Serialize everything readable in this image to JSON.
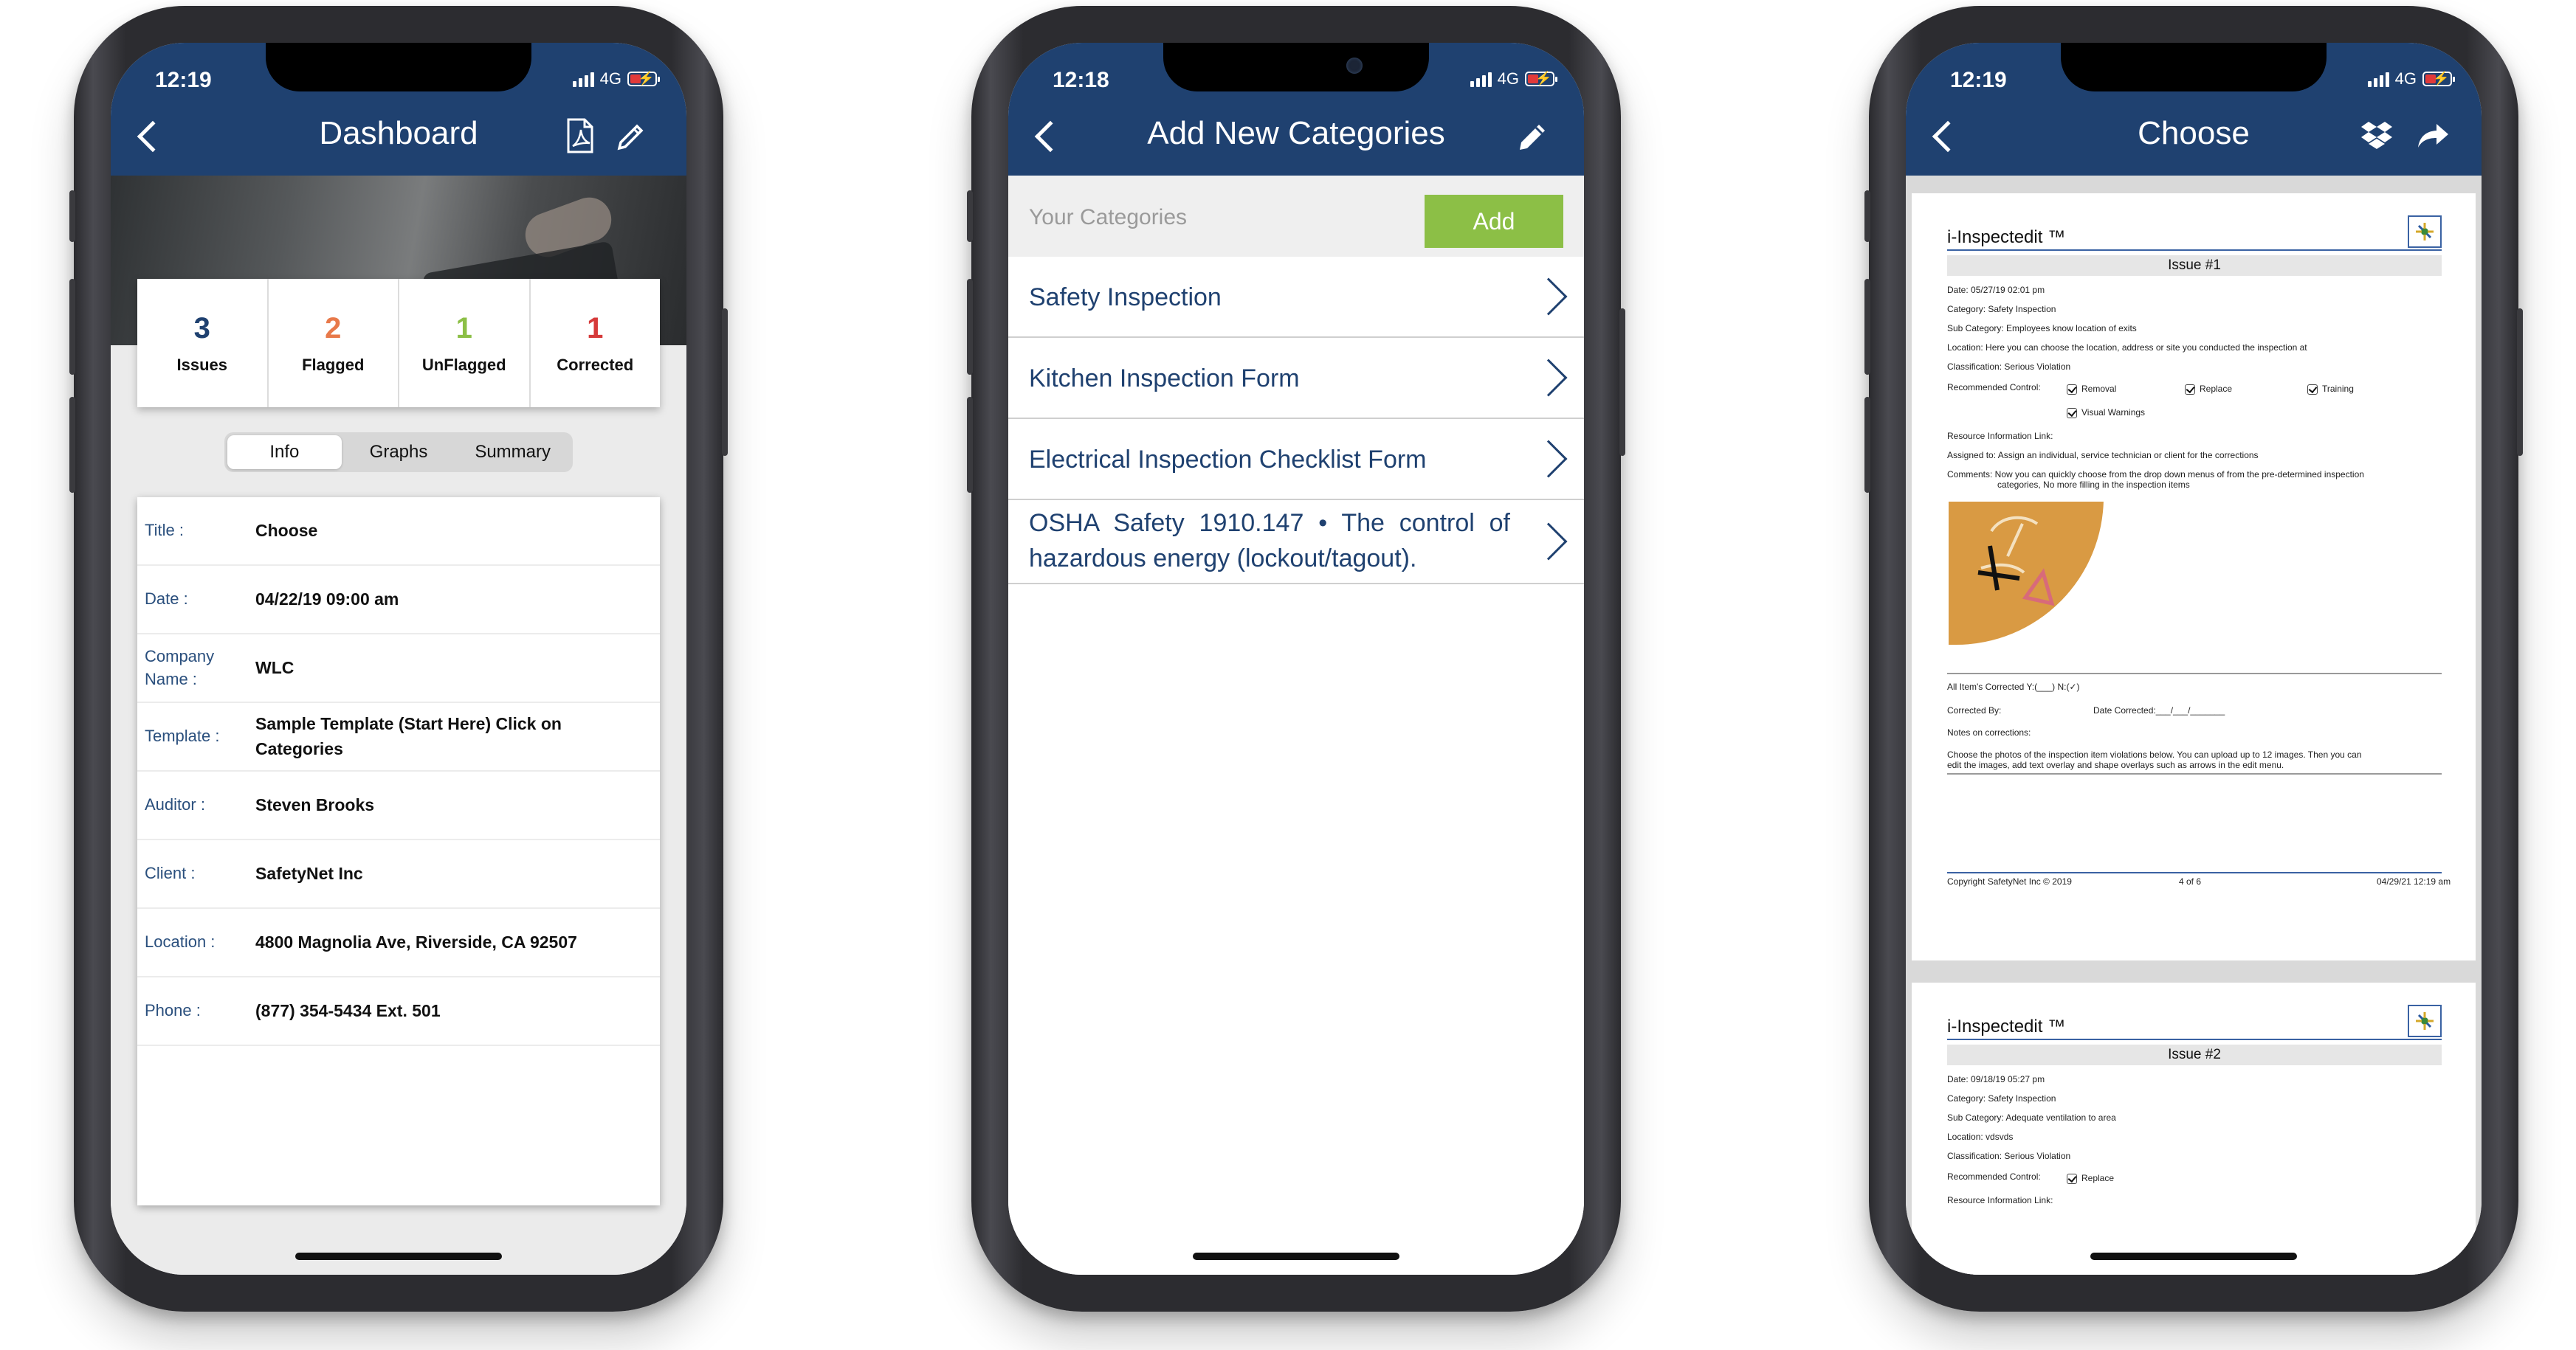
{
  "phones": [
    {
      "status_time": "12:19",
      "network": "4G",
      "title": "Dashboard",
      "stats": [
        {
          "value": "3",
          "label": "Issues",
          "color": "#1f4170"
        },
        {
          "value": "2",
          "label": "Flagged",
          "color": "#e8794a"
        },
        {
          "value": "1",
          "label": "UnFlagged",
          "color": "#8cbf46"
        },
        {
          "value": "1",
          "label": "Corrected",
          "color": "#d63a3a"
        }
      ],
      "tabs": [
        "Info",
        "Graphs",
        "Summary"
      ],
      "active_tab": "Info",
      "info": [
        {
          "key": "Title :",
          "value": "Choose"
        },
        {
          "key": "Date :",
          "value": "04/22/19 09:00 am"
        },
        {
          "key": "Company Name :",
          "value": "WLC"
        },
        {
          "key": "Template :",
          "value": "Sample Template (Start Here) Click on Categories"
        },
        {
          "key": "Auditor :",
          "value": "Steven Brooks"
        },
        {
          "key": "Client :",
          "value": "SafetyNet Inc"
        },
        {
          "key": "Location :",
          "value": "4800 Magnolia Ave, Riverside, CA 92507"
        },
        {
          "key": "Phone :",
          "value": "(877) 354-5434 Ext. 501"
        }
      ]
    },
    {
      "status_time": "12:18",
      "network": "4G",
      "title": "Add New Categories",
      "your_categories_label": "Your Categories",
      "add_label": "Add",
      "categories": [
        "Safety Inspection",
        "Kitchen Inspection Form",
        "Electrical Inspection Checklist Form",
        "OSHA Safety 1910.147 • The control of hazardous energy (lockout/tagout)."
      ]
    },
    {
      "status_time": "12:19",
      "network": "4G",
      "title": "Choose",
      "report_pages": [
        {
          "brand": "i-Inspectedit ™",
          "issue": "Issue #1",
          "date": "Date:  05/27/19 02:01 pm",
          "category": "Category:  Safety Inspection",
          "sub_category": "Sub Category:  Employees know location of exits",
          "location": "Location:  Here you can choose the location, address or site you conducted the inspection at",
          "classification": "Classification:  Serious Violation",
          "recommended_label": "Recommended Control:",
          "controls": [
            "Removal",
            "Replace",
            "Training",
            "Visual Warnings"
          ],
          "resource": "Resource Information Link:",
          "assigned": "Assigned to:  Assign an individual, service technician or client for the corrections",
          "comments_1": "Comments:  Now you can quickly choose from the drop down menus of from the pre-determined inspection",
          "comments_2": "categories, No more filling in the inspection items",
          "corrected_all": "All Item's Corrected  Y:(___)  N:(✓)",
          "corrected_by": "Corrected By:",
          "date_corrected": "Date Corrected:___/___/_______",
          "notes": "Notes on corrections:",
          "photos_1": "Choose the photos of the inspection item violations below. You can upload up to 12 images. Then you can",
          "photos_2": "edit the images, add text overlay and  shape overlays such as arrows in the edit menu.",
          "footer_left": "Copyright SafetyNet Inc © 2019",
          "footer_mid": "4 of 6",
          "footer_right": "04/29/21 12:19 am"
        },
        {
          "brand": "i-Inspectedit ™",
          "issue": "Issue #2",
          "date": "Date:  09/18/19 05:27 pm",
          "category": "Category:  Safety Inspection",
          "sub_category": "Sub Category:  Adequate ventilation to area",
          "location": "Location:  vdsvds",
          "classification": "Classification:  Serious Violation",
          "recommended_label": "Recommended Control:",
          "controls": [
            "Replace"
          ],
          "resource": "Resource Information Link:"
        }
      ]
    }
  ]
}
